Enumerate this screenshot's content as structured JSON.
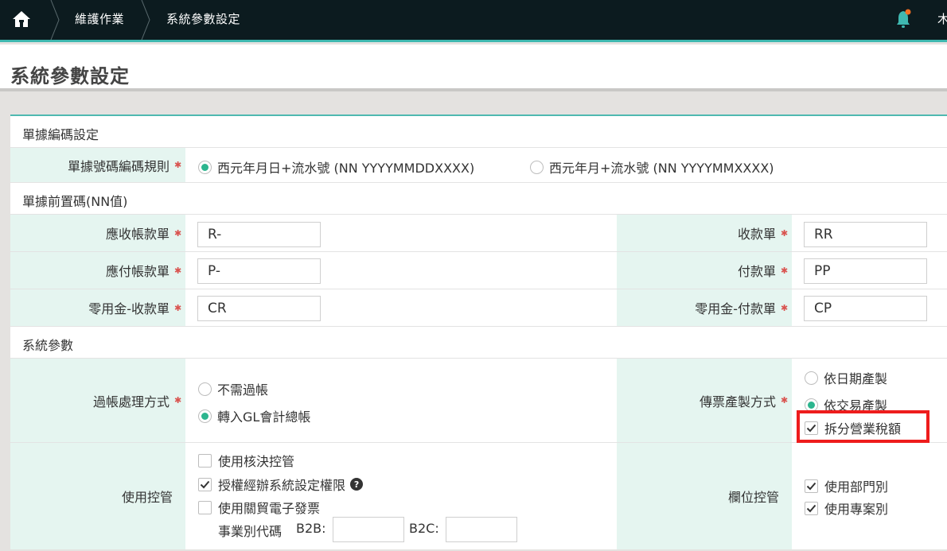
{
  "topbar": {
    "breadcrumb": [
      "維護作業",
      "系統參數設定"
    ],
    "user_initial": "木",
    "home_icon": "home-icon",
    "bell_icon": "bell-icon",
    "accent": "#3fb8b0",
    "notification_dot": "#f36f21"
  },
  "page": {
    "title": "系統參數設定"
  },
  "sections": {
    "doc_code": "單據編碼設定",
    "prefix": "單據前置碼(NN值)",
    "system": "系統參數"
  },
  "doc_number_rule": {
    "label": "單據號碼編碼規則",
    "options": [
      {
        "label": "西元年月日+流水號 (NN YYYYMMDDXXXX)",
        "selected": true
      },
      {
        "label": "西元年月+流水號 (NN YYYYMMXXXX)",
        "selected": false
      }
    ]
  },
  "prefix_fields": {
    "ar": {
      "label": "應收帳款單",
      "value": "R-"
    },
    "receipt": {
      "label": "收款單",
      "value": "RR"
    },
    "ap": {
      "label": "應付帳款單",
      "value": "P-"
    },
    "payment": {
      "label": "付款單",
      "value": "PP"
    },
    "petty_receipt": {
      "label": "零用金-收款單",
      "value": "CR"
    },
    "petty_payment": {
      "label": "零用金-付款單",
      "value": "CP"
    }
  },
  "posting": {
    "label": "過帳處理方式",
    "options": [
      {
        "label": "不需過帳",
        "selected": false
      },
      {
        "label": "轉入GL會計總帳",
        "selected": true
      }
    ]
  },
  "voucher": {
    "label": "傳票產製方式",
    "options": [
      {
        "label": "依日期產製",
        "selected": false
      },
      {
        "label": "依交易產製",
        "selected": true
      }
    ],
    "split_tax": {
      "label": "拆分營業稅額",
      "checked": true
    }
  },
  "usage_control": {
    "label": "使用控管",
    "items": [
      {
        "label": "使用核決控管",
        "checked": false
      },
      {
        "label": "授權經辦系統設定權限",
        "checked": true
      },
      {
        "label": "使用關貿電子發票",
        "checked": false
      }
    ],
    "business_code_label": "事業別代碼",
    "b2b_label": "B2B:",
    "b2c_label": "B2C:",
    "b2b_value": "",
    "b2c_value": ""
  },
  "field_control": {
    "label": "欄位控管",
    "items": [
      {
        "label": "使用部門別",
        "checked": true
      },
      {
        "label": "使用專案別",
        "checked": true
      }
    ]
  }
}
